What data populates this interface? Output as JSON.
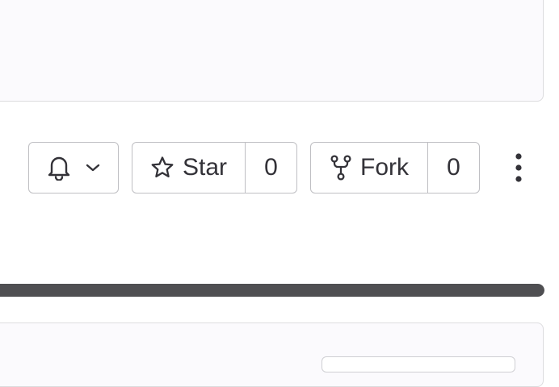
{
  "toolbar": {
    "notifications": {
      "icon": "bell-icon",
      "dropdown_icon": "chevron-down-icon"
    },
    "star": {
      "label": "Star",
      "count": "0",
      "icon": "star-icon"
    },
    "fork": {
      "label": "Fork",
      "count": "0",
      "icon": "fork-icon"
    },
    "more": {
      "icon": "kebab-vertical-icon"
    }
  },
  "progress": {
    "percent": 100,
    "fill_color": "#4f4f52"
  },
  "colors": {
    "panel_bg": "#fbfafd",
    "border": "#bfbfc3",
    "text": "#333238"
  }
}
